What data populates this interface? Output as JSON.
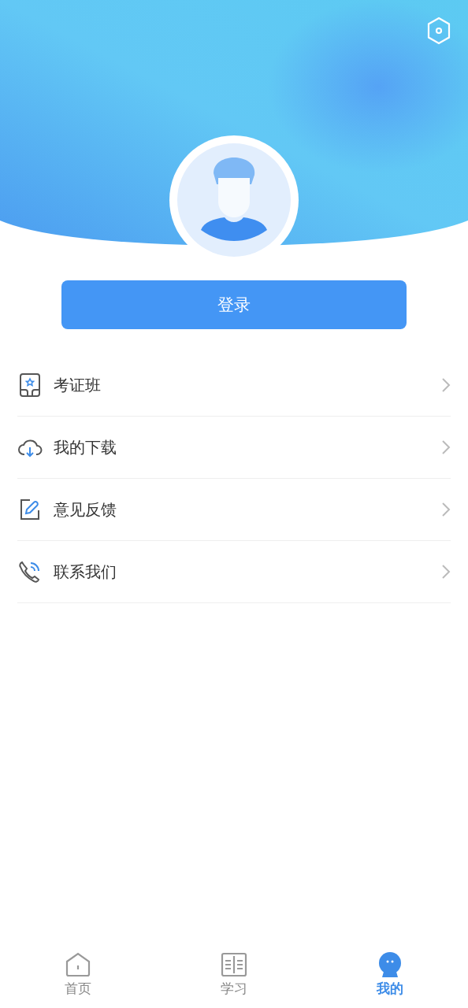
{
  "login_button": "登录",
  "menu": [
    {
      "label": "考证班",
      "kind": "certificate"
    },
    {
      "label": "我的下载",
      "kind": "download"
    },
    {
      "label": "意见反馈",
      "kind": "feedback"
    },
    {
      "label": "联系我们",
      "kind": "contact"
    }
  ],
  "tabs": [
    {
      "label": "首页",
      "kind": "home",
      "selected": false
    },
    {
      "label": "学习",
      "kind": "study",
      "selected": false
    },
    {
      "label": "我的",
      "kind": "mine",
      "selected": true
    }
  ]
}
